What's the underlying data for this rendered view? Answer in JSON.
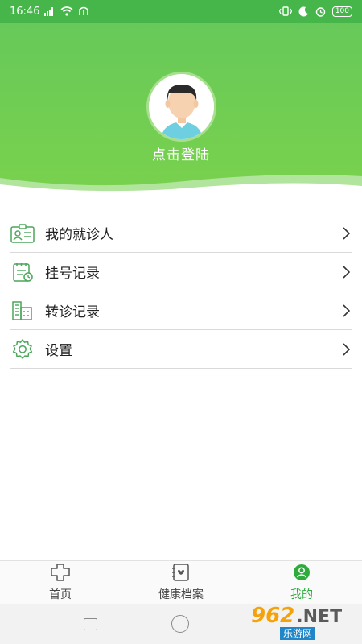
{
  "status_bar": {
    "time": "16:46",
    "battery": "100"
  },
  "profile": {
    "login_text": "点击登陆"
  },
  "menu": {
    "items": [
      {
        "label": "我的就诊人",
        "icon": "patient-card-icon"
      },
      {
        "label": "挂号记录",
        "icon": "registration-record-icon"
      },
      {
        "label": "转诊记录",
        "icon": "building-icon"
      },
      {
        "label": "设置",
        "icon": "gear-icon"
      }
    ]
  },
  "tabbar": {
    "tabs": [
      {
        "label": "首页",
        "icon": "home-cross-icon",
        "active": false
      },
      {
        "label": "健康档案",
        "icon": "health-record-icon",
        "active": false
      },
      {
        "label": "我的",
        "icon": "profile-icon",
        "active": true
      }
    ]
  },
  "watermark": {
    "number": "962",
    "suffix": ".NET",
    "subtitle": "乐游网"
  },
  "colors": {
    "primary_green": "#46b64a",
    "header_green": "#7ad24d",
    "active_tab": "#2eab3c",
    "icon_green": "#4aa65a"
  }
}
